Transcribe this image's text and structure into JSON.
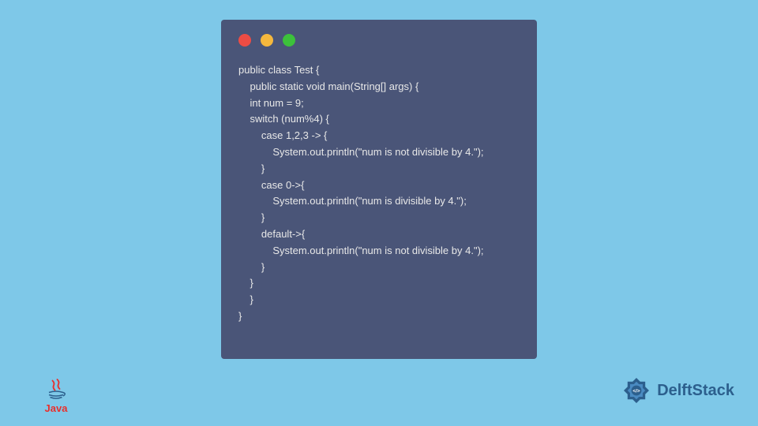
{
  "code": {
    "lines": [
      "public class Test {",
      "    public static void main(String[] args) {",
      "    int num = 9;",
      "    switch (num%4) {",
      "        case 1,2,3 -> {",
      "            System.out.println(\"num is not divisible by 4.\");",
      "        }",
      "        case 0->{",
      "            System.out.println(\"num is divisible by 4.\");",
      "        }",
      "        default->{",
      "            System.out.println(\"num is not divisible by 4.\");",
      "        }",
      "    }",
      "    }",
      "}"
    ]
  },
  "logos": {
    "java_text": "Java",
    "delft_text": "DelftStack"
  },
  "colors": {
    "background": "#7ec8e8",
    "window_bg": "#4a5578",
    "code_text": "#e8e8e8",
    "dot_red": "#ed4c44",
    "dot_yellow": "#f5b83d",
    "dot_green": "#3cc13b",
    "java_red": "#e8302d",
    "delft_blue": "#2c5f8d"
  }
}
